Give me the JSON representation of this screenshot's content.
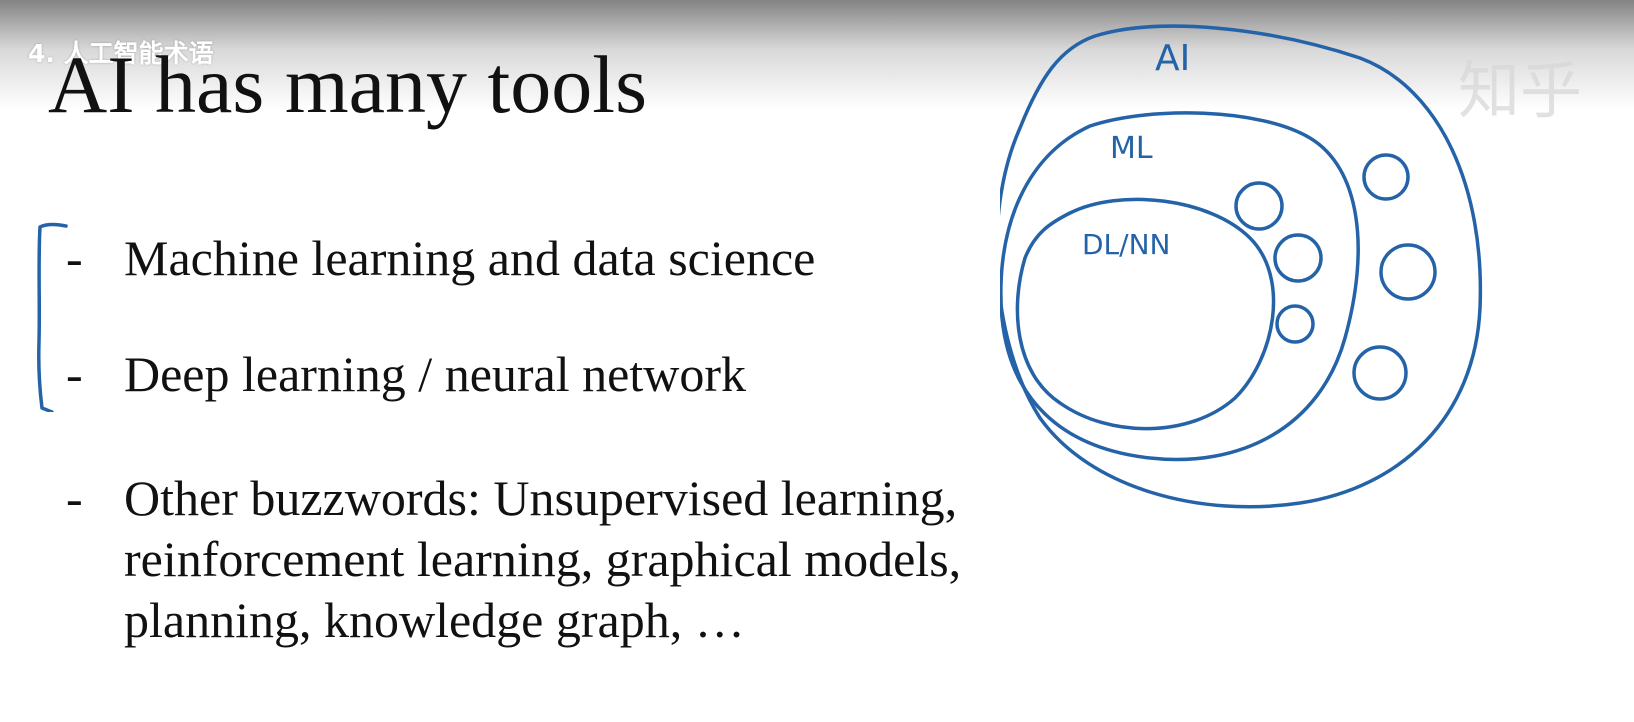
{
  "video": {
    "title": "4. 人工智能术语",
    "watermark": "知乎"
  },
  "slide": {
    "title": "AI has many tools",
    "bullets": [
      {
        "dash": "-",
        "text": "Machine learning and data science"
      },
      {
        "dash": "-",
        "text": "Deep learning / neural network"
      },
      {
        "dash": "-",
        "lines": [
          "Other buzzwords: Unsupervised learning,",
          "reinforcement learning, graphical models,",
          "planning, knowledge graph, …"
        ]
      }
    ]
  },
  "diagram": {
    "ink_color": "#2563a8",
    "labels": {
      "outer": "AI",
      "middle": "ML",
      "inner": "DL/NN"
    }
  }
}
